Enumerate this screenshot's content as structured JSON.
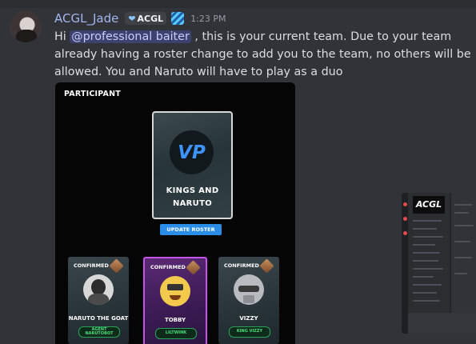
{
  "message": {
    "author": "ACGL_Jade",
    "tag": "ACGL",
    "time": "1:23 PM",
    "greeting": "Hi ",
    "mention": "@professional baiter",
    "text_after_mention": ", this is your current team. Due to your team already having a roster change to add you to the team, no others will be allowed. You and Naruto will have to play as a duo"
  },
  "card": {
    "title": "PARTICIPANT",
    "team_logo_text": "VP",
    "team_name_line1": "KINGS AND",
    "team_name_line2": "NARUTO",
    "update_button": "UPDATE ROSTER",
    "players": [
      {
        "status": "CONFIRMED",
        "name": "NARUTO THE GOAT",
        "account": "AGENT NARUTOBOT"
      },
      {
        "status": "CONFIRMED",
        "name": "TOBBY",
        "account": "LILTWINK"
      },
      {
        "status": "CONFIRMED",
        "name": "VIZZY",
        "account": "KING VIZZY"
      }
    ]
  },
  "thumbnail": {
    "banner_text": "ACGL"
  },
  "colors": {
    "background": "#313338",
    "username": "#a3b6f0",
    "mention_bg": "#3c4270",
    "button": "#2a8ee8",
    "confirmed_account": "#4ddc7c",
    "featured_border": "#c653e8"
  },
  "icons": {
    "tag_icon": "heart-icon",
    "badge_icon": "stripe-badge-icon",
    "rank_icon": "rank-diamond-icon"
  }
}
